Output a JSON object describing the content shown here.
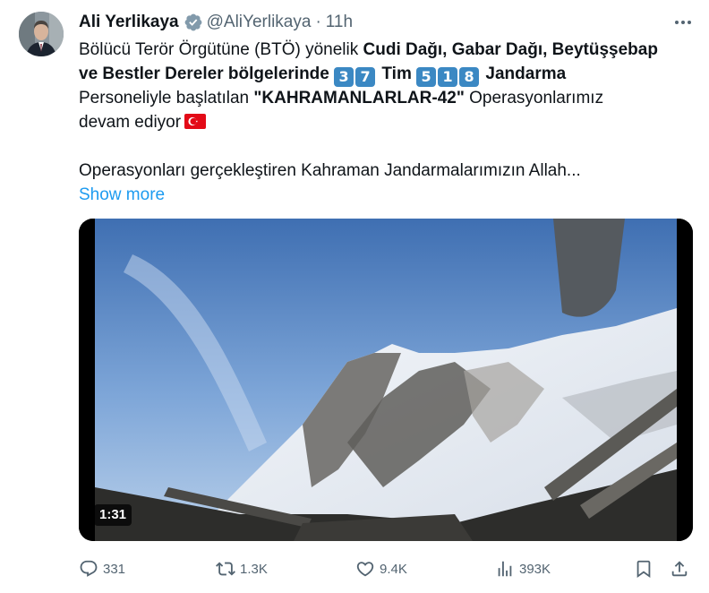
{
  "author": {
    "name": "Ali Yerlikaya",
    "handle": "@AliYerlikaya",
    "separator": "·",
    "time": "11h"
  },
  "post": {
    "line1": {
      "t1": "Bölücü Terör Örgütüne (BTÖ) yönelik ",
      "b1": "Cudi Dağı, Gabar Dağı, Beytüşşebap"
    },
    "line2": {
      "b1": "ve Bestler Dereler bölgelerinde ",
      "k1": "3",
      "k2": "7",
      "b2": " Tim ",
      "k3": "5",
      "k4": "1",
      "k5": "8",
      "b3": " Jandarma"
    },
    "line3": {
      "t1": "Personeliyle başlatılan ",
      "b1": "\"KAHRAMANLARLAR-42\"",
      "t2": " Operasyonlarımız"
    },
    "line4": {
      "t1": "devam ediyor"
    },
    "line5": {
      "t1": "Operasyonları gerçekleştiren Kahraman Jandarmalarımızın Allah..."
    },
    "show_more": "Show more"
  },
  "video": {
    "duration": "1:31"
  },
  "actions": {
    "replies": "331",
    "reposts": "1.3K",
    "likes": "9.4K",
    "views": "393K"
  },
  "colors": {
    "accent": "#1d9bf0",
    "muted": "#536471",
    "text": "#0f1419",
    "keycap": "#3b88c3",
    "flag_red": "#e30a17"
  },
  "icons": [
    "verified-badge-icon",
    "more-icon",
    "turkey-flag-icon",
    "reply-icon",
    "repost-icon",
    "like-icon",
    "views-icon",
    "bookmark-icon",
    "share-icon"
  ]
}
